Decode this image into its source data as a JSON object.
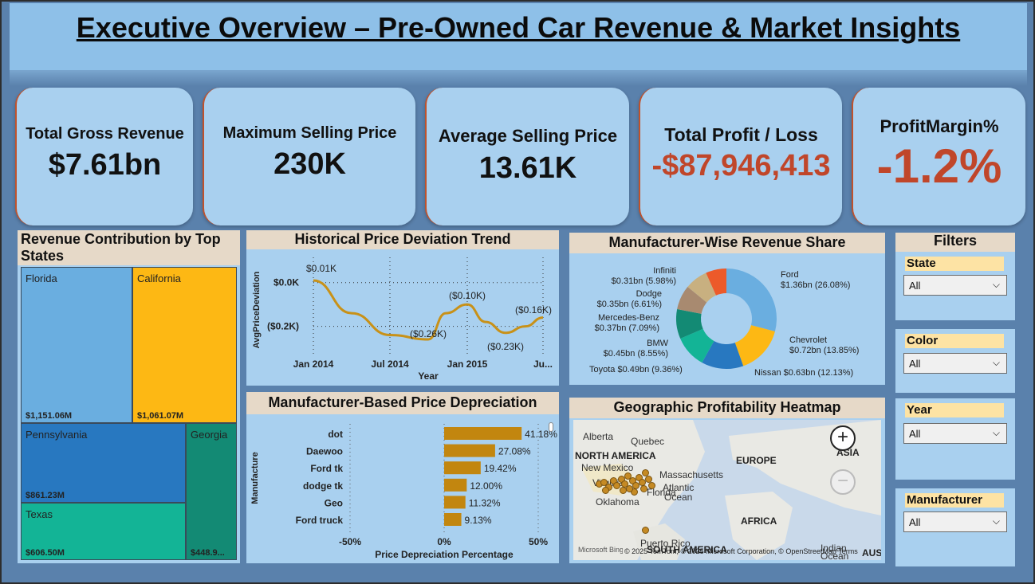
{
  "title": "Executive Overview – Pre-Owned Car Revenue & Market Insights",
  "kpis": {
    "gross_revenue": {
      "label": "Total Gross Revenue",
      "value": "$7.61bn"
    },
    "max_price": {
      "label": "Maximum Selling Price",
      "value": "230K"
    },
    "avg_price": {
      "label": "Average Selling Price",
      "value": "13.61K"
    },
    "profit_loss": {
      "label": "Total Profit / Loss",
      "value": "-$87,946,413"
    },
    "profit_margin": {
      "label": "ProfitMargin%",
      "value": "-1.2%"
    }
  },
  "treemap": {
    "title": "Revenue Contribution by Top States",
    "items": [
      {
        "state": "Florida",
        "value": "$1,151.06M",
        "color": "#6aaee0"
      },
      {
        "state": "California",
        "value": "$1,061.07M",
        "color": "#fdb814"
      },
      {
        "state": "Pennsylvania",
        "value": "$861.23M",
        "color": "#2878c0"
      },
      {
        "state": "Georgia",
        "value": "$448.9...",
        "color": "#138a74"
      },
      {
        "state": "Texas",
        "value": "$606.50M",
        "color": "#13b496"
      }
    ]
  },
  "line_chart": {
    "title": "Historical Price Deviation Trend",
    "ylabel": "AvgPriceDeviation",
    "xlabel": "Year",
    "yticks": [
      "$0.0K",
      "($0.2K)"
    ],
    "xticks": [
      "Jan 2014",
      "Jul 2014",
      "Jan 2015",
      "Ju..."
    ],
    "data_labels": [
      "$0.01K",
      "($0.26K)",
      "($0.10K)",
      "($0.23K)",
      "($0.16K)"
    ]
  },
  "bar_chart": {
    "title": "Manufacturer-Based Price Depreciation",
    "ylabel": "Manufacture",
    "xlabel": "Price Depreciation Percentage",
    "xticks": [
      "-50%",
      "0%",
      "50%"
    ],
    "labels": [
      "41.18%",
      "27.08%",
      "19.42%",
      "12.00%",
      "11.32%",
      "9.13%"
    ]
  },
  "donut": {
    "title": "Manufacturer-Wise Revenue Share",
    "labels": [
      {
        "name": "Ford",
        "value": "$1.36bn (26.08%)"
      },
      {
        "name": "Chevrolet",
        "value": "$0.72bn (13.85%)"
      },
      {
        "name": "Nissan",
        "text": "Nissan $0.63bn (12.13%)"
      },
      {
        "name": "Toyota",
        "text": "Toyota $0.49bn (9.36%)"
      },
      {
        "name": "BMW",
        "value": "$0.45bn (8.55%)"
      },
      {
        "name": "Mercedes-Benz",
        "value": "$0.37bn (7.09%)"
      },
      {
        "name": "Dodge",
        "value": "$0.35bn (6.61%)"
      },
      {
        "name": "Infiniti",
        "value": "$0.31bn (5.98%)"
      }
    ]
  },
  "map": {
    "title": "Geographic Profitability Heatmap",
    "labels": [
      "Alberta",
      "Quebec",
      "NORTH AMERICA",
      "New Mexico",
      "Virginia",
      "Massachusetts",
      "Atlantic",
      "Ocean",
      "Florida",
      "Oklahoma",
      "EUROPE",
      "ASIA",
      "AFRICA",
      "Puerto Rico",
      "SOUTH AMERICA",
      "Indian",
      "Ocean",
      "AUS"
    ],
    "attribution": "© 2025 TomTom, © 2025 Microsoft Corporation, © OpenStreetMap  Terms",
    "brand": "Microsoft Bing"
  },
  "filters": {
    "title": "Filters",
    "state": {
      "label": "State",
      "value": "All"
    },
    "color": {
      "label": "Color",
      "value": "All"
    },
    "year": {
      "label": "Year",
      "value": "All"
    },
    "manufacturer": {
      "label": "Manufacturer",
      "value": "All"
    }
  },
  "chart_data": [
    {
      "type": "area",
      "title": "Revenue Contribution by Top States",
      "categories": [
        "Florida",
        "California",
        "Pennsylvania",
        "Texas",
        "Georgia"
      ],
      "values": [
        1151.06,
        1061.07,
        861.23,
        606.5,
        448.9
      ],
      "unit": "$M"
    },
    {
      "type": "line",
      "title": "Historical Price Deviation Trend",
      "xlabel": "Year",
      "ylabel": "AvgPriceDeviation",
      "x": [
        "2014-01",
        "2014-07",
        "2015-01",
        "2015-04",
        "2015-07"
      ],
      "y": [
        0.01,
        -0.26,
        -0.1,
        -0.23,
        -0.16
      ],
      "unit": "$K"
    },
    {
      "type": "bar",
      "title": "Manufacturer-Based Price Depreciation",
      "xlabel": "Price Depreciation Percentage",
      "ylabel": "Manufacture",
      "categories": [
        "dot",
        "Daewoo",
        "Ford tk",
        "dodge tk",
        "Geo",
        "Ford truck"
      ],
      "values": [
        41.18,
        27.08,
        19.42,
        12.0,
        11.32,
        9.13
      ],
      "xlim": [
        -50,
        50
      ]
    },
    {
      "type": "pie",
      "title": "Manufacturer-Wise Revenue Share",
      "categories": [
        "Ford",
        "Chevrolet",
        "Nissan",
        "Toyota",
        "BMW",
        "Mercedes-Benz",
        "Dodge",
        "Infiniti"
      ],
      "values": [
        26.08,
        13.85,
        12.13,
        9.36,
        8.55,
        7.09,
        6.61,
        5.98
      ],
      "colors": [
        "#6aaee0",
        "#fdb814",
        "#2878c0",
        "#13b496",
        "#138a74",
        "#a88a70",
        "#c8b080",
        "#ec5a2a"
      ]
    }
  ]
}
